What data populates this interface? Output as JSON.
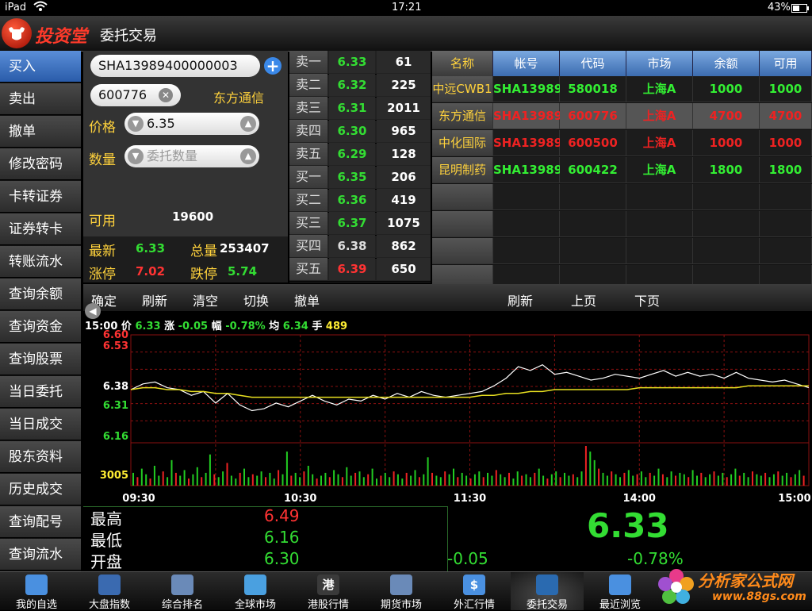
{
  "status": {
    "device": "iPad",
    "time": "17:21",
    "battery": "43%"
  },
  "header": {
    "logo": "投资堂",
    "title": "委托交易"
  },
  "sidebar": {
    "items": [
      "买入",
      "卖出",
      "撤单",
      "修改密码",
      "卡转证券",
      "证券转卡",
      "转账流水",
      "查询余额",
      "查询资金",
      "查询股票",
      "当日委托",
      "当日成交",
      "股东资料",
      "历史成交",
      "查询配号",
      "查询流水"
    ]
  },
  "order": {
    "account": "SHA13989400000003",
    "code": "600776",
    "stock_name": "东方通信",
    "price_label": "价格",
    "price": "6.35",
    "qty_label": "数量",
    "qty_placeholder": "委托数量",
    "available_label": "可用",
    "available": "19600",
    "latest_label": "最新",
    "latest": "6.33",
    "total_label": "总量",
    "total": "253407",
    "limit_up_label": "涨停",
    "limit_up": "7.02",
    "limit_down_label": "跌停",
    "limit_down": "5.74"
  },
  "orderbook": [
    {
      "label": "卖一",
      "price": "6.33",
      "vol": "61",
      "color": "#33dd33"
    },
    {
      "label": "卖二",
      "price": "6.32",
      "vol": "225",
      "color": "#33dd33"
    },
    {
      "label": "卖三",
      "price": "6.31",
      "vol": "2011",
      "color": "#33dd33"
    },
    {
      "label": "卖四",
      "price": "6.30",
      "vol": "965",
      "color": "#33dd33"
    },
    {
      "label": "卖五",
      "price": "6.29",
      "vol": "128",
      "color": "#33dd33"
    },
    {
      "label": "买一",
      "price": "6.35",
      "vol": "206",
      "color": "#33dd33"
    },
    {
      "label": "买二",
      "price": "6.36",
      "vol": "419",
      "color": "#33dd33"
    },
    {
      "label": "买三",
      "price": "6.37",
      "vol": "1075",
      "color": "#33dd33"
    },
    {
      "label": "买四",
      "price": "6.38",
      "vol": "862",
      "color": "#dddddd"
    },
    {
      "label": "买五",
      "price": "6.39",
      "vol": "650",
      "color": "#ff3333"
    }
  ],
  "holdings": {
    "headers": [
      "名称",
      "帐号",
      "代码",
      "市场",
      "余额",
      "可用"
    ],
    "rows": [
      {
        "cells": [
          "中远CWB1",
          "SHA13989",
          "580018",
          "上海A",
          "1000",
          "1000"
        ],
        "color": "#33ee33"
      },
      {
        "cells": [
          "东方通信",
          "SHA13989",
          "600776",
          "上海A",
          "4700",
          "4700"
        ],
        "color": "#ee2222"
      },
      {
        "cells": [
          "中化国际",
          "SHA13989",
          "600500",
          "上海A",
          "1000",
          "1000"
        ],
        "color": "#ee2222"
      },
      {
        "cells": [
          "昆明制药",
          "SHA13989",
          "600422",
          "上海A",
          "1800",
          "1800"
        ],
        "color": "#33ee33"
      }
    ]
  },
  "toolbar": {
    "left": [
      "确定",
      "刷新",
      "清空",
      "切换",
      "撤单"
    ],
    "right": [
      "刷新",
      "上页",
      "下页"
    ]
  },
  "chart_info": {
    "time_label": "15:00",
    "price_label": "价",
    "price": "6.33",
    "change_label": "涨",
    "change": "-0.05",
    "pct_label": "幅",
    "pct": "-0.78%",
    "avg_label": "均",
    "avg": "6.34",
    "vol_label": "手",
    "vol": "489"
  },
  "chart_data": {
    "type": "line",
    "y_ticks": [
      "6.60",
      "6.53",
      "6.38",
      "6.31",
      "6.16",
      "3005"
    ],
    "x_ticks": [
      "09:30",
      "10:30",
      "11:30",
      "14:00",
      "15:00"
    ],
    "ylim": [
      6.06,
      6.6
    ],
    "series": [
      {
        "values": [
          6.33,
          6.36,
          6.37,
          6.34,
          6.33,
          6.3,
          6.32,
          6.26,
          6.31,
          6.25,
          6.22,
          6.23,
          6.26,
          6.24,
          6.27,
          6.3,
          6.27,
          6.25,
          6.28,
          6.27,
          6.3,
          6.28,
          6.31,
          6.29,
          6.32,
          6.3,
          6.29,
          6.3,
          6.31,
          6.32,
          6.35,
          6.39,
          6.45,
          6.43,
          6.46,
          6.41,
          6.42,
          6.4,
          6.38,
          6.39,
          6.41,
          6.4,
          6.39,
          6.41,
          6.43,
          6.4,
          6.42,
          6.4,
          6.41,
          6.39,
          6.42,
          6.39,
          6.38,
          6.37,
          6.38,
          6.36,
          6.34
        ]
      },
      {
        "values": [
          6.33,
          6.34,
          6.34,
          6.33,
          6.33,
          6.32,
          6.32,
          6.31,
          6.31,
          6.3,
          6.29,
          6.29,
          6.29,
          6.29,
          6.29,
          6.29,
          6.29,
          6.29,
          6.29,
          6.29,
          6.29,
          6.29,
          6.29,
          6.29,
          6.29,
          6.29,
          6.29,
          6.29,
          6.29,
          6.3,
          6.3,
          6.31,
          6.31,
          6.32,
          6.32,
          6.33,
          6.33,
          6.33,
          6.33,
          6.33,
          6.33,
          6.33,
          6.34,
          6.34,
          6.34,
          6.34,
          6.34,
          6.34,
          6.34,
          6.34,
          6.34,
          6.35,
          6.35,
          6.35,
          6.35,
          6.35,
          6.35
        ]
      }
    ],
    "volume": [
      9,
      6,
      12,
      8,
      5,
      14,
      7,
      10,
      6,
      18,
      9,
      7,
      11,
      5,
      8,
      13,
      6,
      9,
      22,
      8,
      6,
      10,
      16,
      7,
      5,
      9,
      12,
      6,
      8,
      7,
      10,
      6,
      9,
      5,
      11,
      8,
      24,
      7,
      9,
      6,
      10,
      14,
      8,
      5,
      7,
      9,
      6,
      11,
      8,
      6,
      13,
      7,
      9,
      10,
      6,
      8,
      12,
      5,
      7,
      9,
      6,
      10,
      8,
      5,
      9,
      7,
      11,
      6,
      8,
      20,
      9,
      7,
      6,
      10,
      8,
      12,
      6,
      9,
      7,
      5,
      8,
      10,
      6,
      9,
      7,
      11,
      8,
      6,
      9,
      5,
      10,
      7,
      8,
      6,
      9,
      12,
      7,
      5,
      8,
      10,
      6,
      9,
      7,
      8,
      6,
      10,
      28,
      24,
      18,
      12,
      9,
      7,
      10,
      8,
      6,
      9,
      11,
      7,
      8,
      10,
      6,
      9,
      7,
      12,
      8,
      6,
      10,
      7,
      9,
      8,
      6,
      11,
      7,
      9,
      6,
      8,
      10,
      7,
      9,
      6,
      8,
      12,
      7,
      9,
      6,
      10,
      8,
      7,
      9,
      6,
      8,
      10,
      7,
      9,
      6,
      8,
      11,
      7
    ]
  },
  "summary": {
    "high_label": "最高",
    "high": "6.49",
    "low_label": "最低",
    "low": "6.16",
    "open_label": "开盘",
    "open": "6.30",
    "last": "6.33",
    "change": "-0.05",
    "pct": "-0.78%"
  },
  "tabs": [
    {
      "label": "我的自选",
      "color": "#4a90e0"
    },
    {
      "label": "大盘指数",
      "color": "#3a6ab0"
    },
    {
      "label": "综合排名",
      "color": "#6a8ab8"
    },
    {
      "label": "全球市场",
      "color": "#4aa0e0"
    },
    {
      "label": "港股行情",
      "color": "#3a3a3a",
      "glyph": "港"
    },
    {
      "label": "期货市场",
      "color": "#6a8ab8"
    },
    {
      "label": "外汇行情",
      "color": "#4a90e0",
      "glyph": "$"
    },
    {
      "label": "委托交易",
      "color": "#2a6ab0"
    },
    {
      "label": "最近浏览",
      "color": "#4a90e0"
    }
  ],
  "watermark": {
    "line1": "分析家公式网",
    "line2": "www.88gs.com"
  },
  "colors": {
    "up": "#ff3333",
    "down": "#33dd33",
    "label": "#ffd23c",
    "accent": "#2a5caa"
  }
}
